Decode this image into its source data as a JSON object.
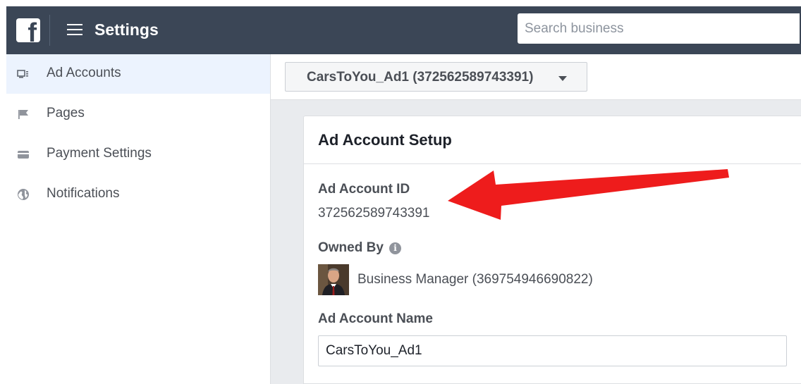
{
  "header": {
    "logo_letter": "f",
    "title": "Settings",
    "search_placeholder": "Search business"
  },
  "sidebar": {
    "items": [
      {
        "label": "Ad Accounts",
        "icon": "ad-accounts-icon",
        "active": true
      },
      {
        "label": "Pages",
        "icon": "flag-icon",
        "active": false
      },
      {
        "label": "Payment Settings",
        "icon": "credit-card-icon",
        "active": false
      },
      {
        "label": "Notifications",
        "icon": "globe-icon",
        "active": false
      }
    ]
  },
  "account_selector": {
    "value": "CarsToYou_Ad1 (372562589743391)"
  },
  "card": {
    "title": "Ad Account Setup",
    "account_id_label": "Ad Account ID",
    "account_id_value": "372562589743391",
    "owned_by_label": "Owned By",
    "owner_name": "Business Manager (369754946690822)",
    "account_name_label": "Ad Account Name",
    "account_name_value": "CarsToYou_Ad1"
  },
  "colors": {
    "topbar": "#3b4656",
    "active_item_bg": "#ecf3fe",
    "annotation_arrow": "#ee1c1c"
  }
}
